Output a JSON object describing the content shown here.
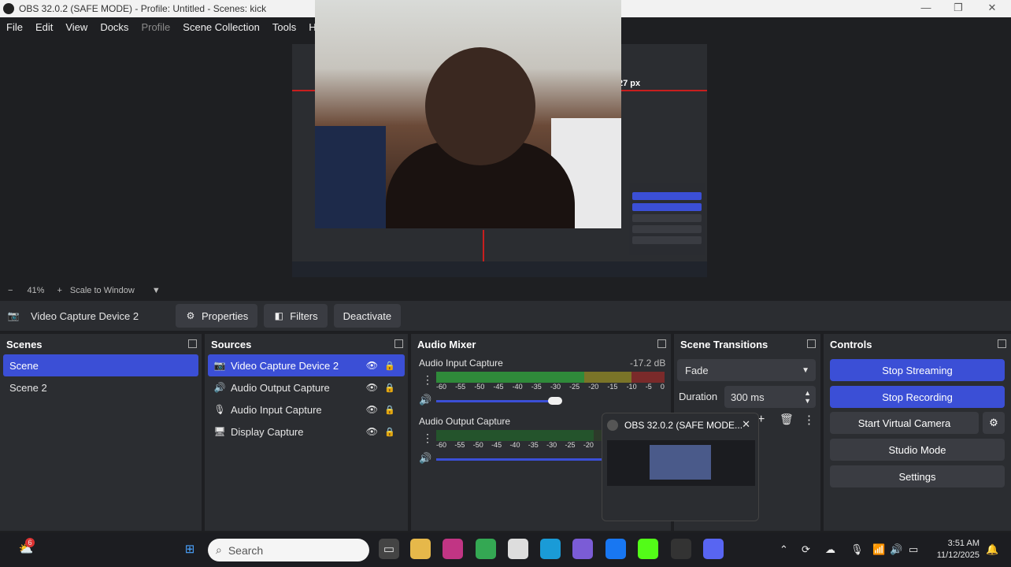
{
  "window": {
    "title": "OBS 32.0.2 (SAFE MODE) - Profile: Untitled - Scenes: kick"
  },
  "menu": [
    "File",
    "Edit",
    "View",
    "Docks",
    "Profile",
    "Scene Collection",
    "Tools",
    "Help"
  ],
  "preview": {
    "overlay_text": "27 px"
  },
  "zoom": {
    "minus": "−",
    "value": "41%",
    "plus": "+",
    "mode": "Scale to Window"
  },
  "source_toolbar": {
    "name": "Video Capture Device 2",
    "properties": "Properties",
    "filters": "Filters",
    "deactivate": "Deactivate"
  },
  "scenes": {
    "title": "Scenes",
    "items": [
      "Scene",
      "Scene 2"
    ]
  },
  "sources": {
    "title": "Sources",
    "items": [
      "Video Capture Device 2",
      "Audio Output Capture",
      "Audio Input Capture",
      "Display Capture"
    ]
  },
  "mixer": {
    "title": "Audio Mixer",
    "channels": [
      {
        "name": "Audio Input Capture",
        "db": "-17.2 dB"
      },
      {
        "name": "Audio Output Capture",
        "db": ""
      }
    ],
    "ticks": [
      "-60",
      "-55",
      "-50",
      "-45",
      "-40",
      "-35",
      "-30",
      "-25",
      "-20",
      "-15",
      "-10",
      "-5",
      "0"
    ]
  },
  "transitions": {
    "title": "Scene Transitions",
    "type": "Fade",
    "duration_label": "Duration",
    "duration_value": "300 ms"
  },
  "controls": {
    "title": "Controls",
    "stop_streaming": "Stop Streaming",
    "stop_recording": "Stop Recording",
    "start_virtual_camera": "Start Virtual Camera",
    "studio_mode": "Studio Mode",
    "settings": "Settings"
  },
  "popup": {
    "title": "OBS 32.0.2 (SAFE MODE..."
  },
  "taskbar": {
    "search_placeholder": "Search",
    "badge_count": "6",
    "time": "3:51 AM",
    "date": "11/12/2025"
  },
  "colors": {
    "accent": "#3b4fd6",
    "panel": "#2b2d31",
    "background": "#1e1f22"
  }
}
